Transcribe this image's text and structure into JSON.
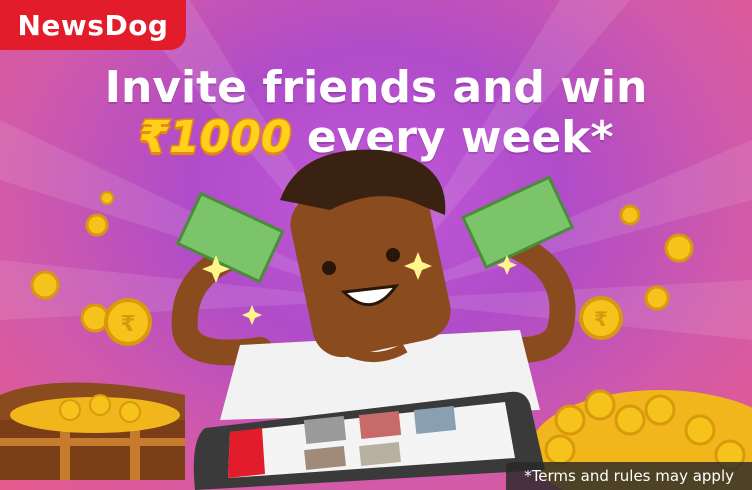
{
  "brand": {
    "logo_text": "NewsDog"
  },
  "headline": {
    "line1": "Invite friends and win",
    "amount": "₹1000",
    "line2_rest": " every week*"
  },
  "footer": {
    "terms": "*Terms and rules may apply"
  },
  "colors": {
    "brand_red": "#e21c2a",
    "background_purple": "#b04cc9",
    "gold": "#ffd11a"
  },
  "icons": [
    "rupee-coin-icon",
    "banknote-icon",
    "sparkle-icon",
    "treasure-chest-icon",
    "phone-icon"
  ]
}
